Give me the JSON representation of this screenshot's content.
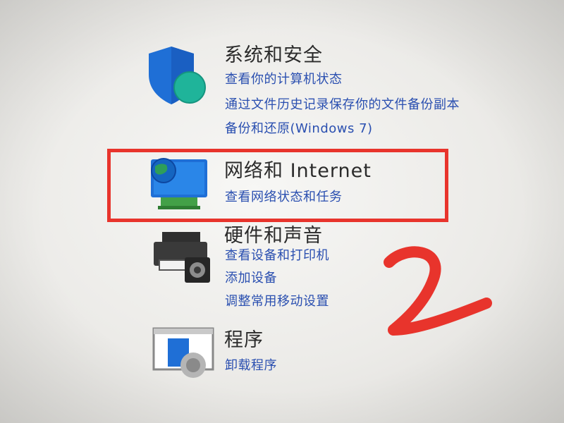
{
  "categories": [
    {
      "id": "system-security",
      "title": "系统和安全",
      "icon": "shield-icon",
      "links": [
        "查看你的计算机状态",
        "通过文件历史记录保存你的文件备份副本",
        "备份和还原(Windows 7)"
      ]
    },
    {
      "id": "network-internet",
      "title": "网络和 Internet",
      "icon": "network-globe-icon",
      "links": [
        "查看网络状态和任务"
      ]
    },
    {
      "id": "hardware-sound",
      "title": "硬件和声音",
      "icon": "printer-speaker-icon",
      "links": [
        "查看设备和打印机",
        "添加设备",
        "调整常用移动设置"
      ]
    },
    {
      "id": "programs",
      "title": "程序",
      "icon": "programs-icon",
      "links": [
        "卸载程序"
      ]
    }
  ],
  "annotation": {
    "highlight_color": "#e8342c",
    "number_shape": "2"
  },
  "colors": {
    "link": "#2a4fb0",
    "title": "#2b2b2b"
  }
}
